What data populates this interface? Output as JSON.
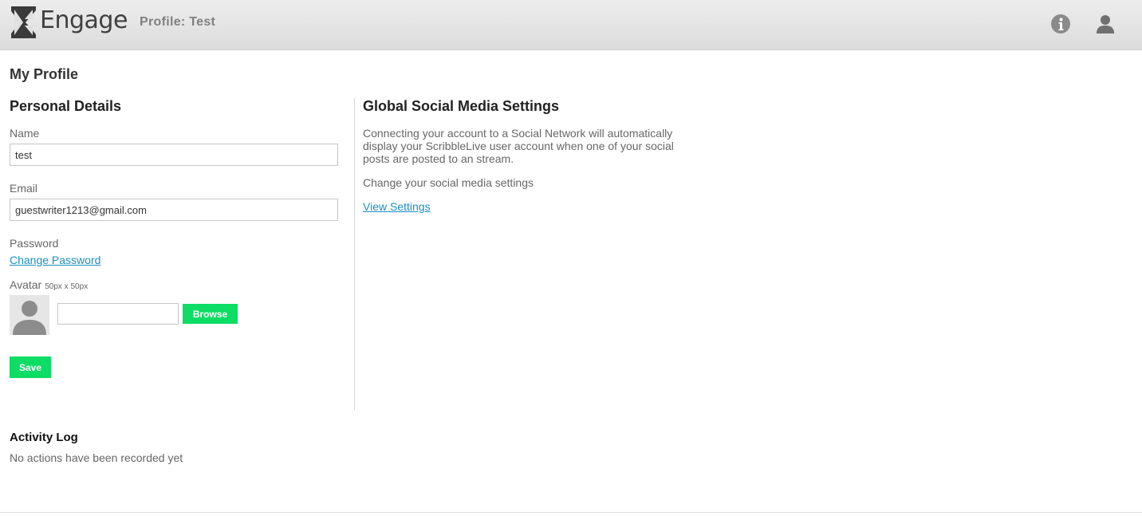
{
  "header": {
    "app_name": "Engage",
    "profile_title": "Profile: Test",
    "icons": [
      "logo-x-icon",
      "info-icon",
      "user-icon"
    ]
  },
  "page": {
    "title": "My Profile"
  },
  "personal_details": {
    "title": "Personal Details",
    "name_label": "Name",
    "name_value": "test",
    "email_label": "Email",
    "email_value": "guestwriter1213@gmail.com",
    "password_label": "Password",
    "change_password_link": "Change Password",
    "avatar_label": "Avatar",
    "avatar_size_note": "50px x 50px",
    "avatar_file_value": "",
    "browse_button": "Browse",
    "save_button": "Save"
  },
  "social": {
    "title": "Global Social Media Settings",
    "description": "Connecting your account to a Social Network will automatically display your ScribbleLive user account when one of your social posts are posted to an stream.",
    "change_text": "Change your social media settings",
    "view_settings_link": "View Settings"
  },
  "activity_log": {
    "title": "Activity Log",
    "empty_text": "No actions have been recorded yet"
  },
  "colors": {
    "accent_green": "#0ddc65",
    "link_blue": "#1a8fbf",
    "header_bg": "#e6e6e6"
  }
}
